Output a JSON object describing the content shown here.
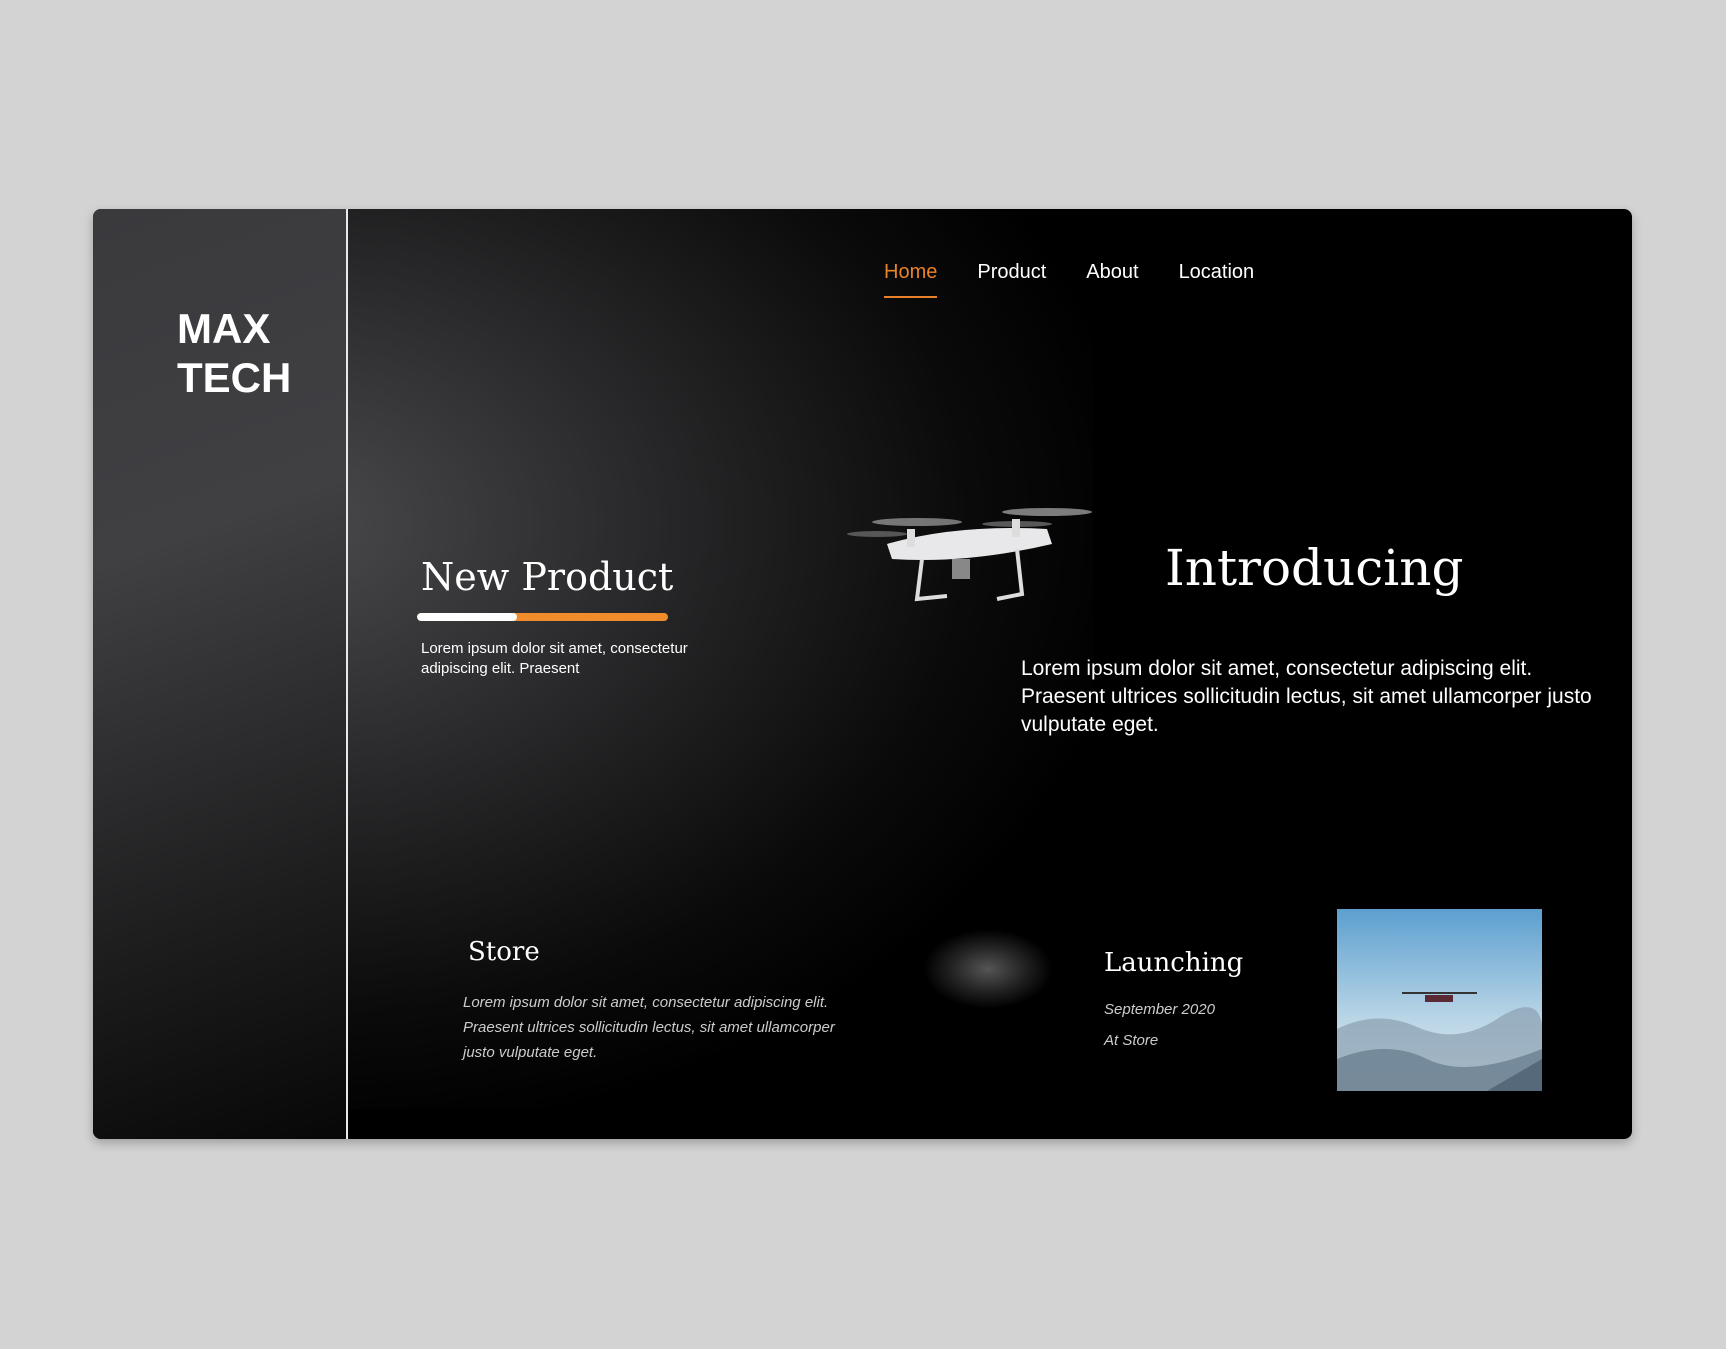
{
  "brand": {
    "line1": "MAX",
    "line2": "TECH"
  },
  "nav": {
    "items": [
      {
        "label": "Home",
        "active": true
      },
      {
        "label": "Product"
      },
      {
        "label": "About"
      },
      {
        "label": "Location"
      }
    ]
  },
  "new_product": {
    "title": "New Product",
    "progress_percent": 40,
    "text": "Lorem ipsum dolor sit amet, consectetur adipiscing elit. Praesent"
  },
  "intro": {
    "title": "Introducing",
    "text": "Lorem ipsum dolor sit amet, consectetur adipiscing elit. Praesent ultrices sollicitudin lectus, sit amet ullamcorper justo vulputate eget."
  },
  "store": {
    "title": "Store",
    "text": "Lorem ipsum dolor sit amet, consectetur adipiscing elit. Praesent ultrices sollicitudin lectus, sit amet ullamcorper justo vulputate eget."
  },
  "launch": {
    "title": "Launching",
    "date": "September 2020",
    "place": "At Store"
  },
  "colors": {
    "accent": "#e8822a"
  }
}
